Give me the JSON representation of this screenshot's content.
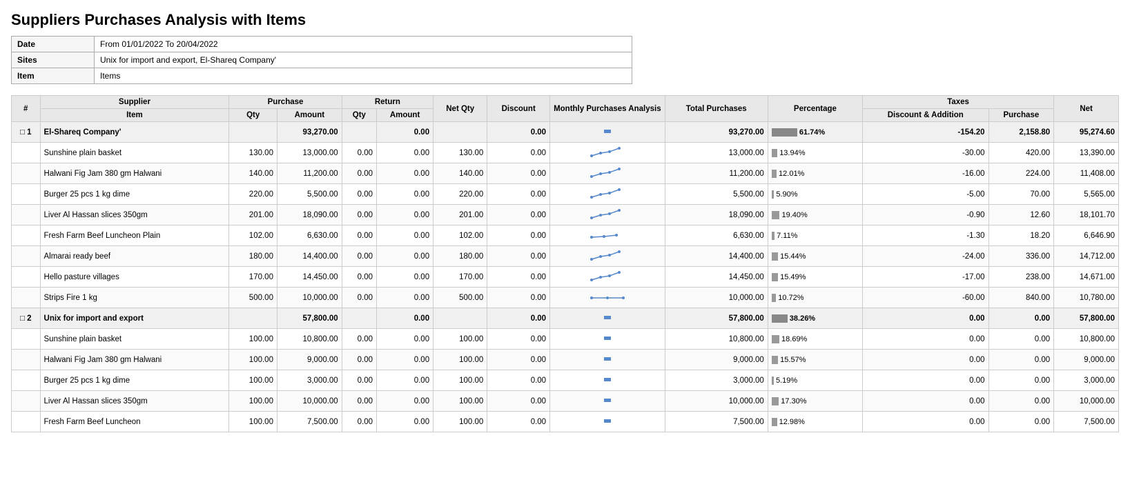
{
  "title": "Suppliers Purchases Analysis with Items",
  "meta": {
    "date_label": "Date",
    "date_value": "From 01/01/2022 To 20/04/2022",
    "sites_label": "Sites",
    "sites_value": "Unix for import and export, El-Shareq Company'",
    "item_label": "Item",
    "item_value": "Items"
  },
  "table": {
    "headers": {
      "hash": "#",
      "supplier": "Supplier",
      "item": "Item",
      "purchase": "Purchase",
      "purchase_qty": "Qty",
      "purchase_amount": "Amount",
      "return": "Return",
      "return_qty": "Qty",
      "return_amount": "Amount",
      "net_qty": "Net Qty",
      "discount": "Discount",
      "monthly_analysis": "Monthly Purchases Analysis",
      "total_purchases": "Total Purchases",
      "percentage": "Percentage",
      "taxes": "Taxes",
      "taxes_discount": "Discount & Addition",
      "taxes_purchase": "Purchase",
      "net": "Net"
    },
    "suppliers": [
      {
        "id": 1,
        "name": "El-Shareq Company'",
        "purchase_amount": "93,270.00",
        "return_amount": "0.00",
        "discount": "0.00",
        "total_purchases": "93,270.00",
        "percentage": 61.74,
        "percentage_label": "61.74%",
        "taxes_discount": "-154.20",
        "taxes_purchase": "2,158.80",
        "net": "95,274.60",
        "items": [
          {
            "name": "Sunshine plain basket",
            "purchase_qty": "130.00",
            "purchase_amount": "13,000.00",
            "return_qty": "0.00",
            "return_amount": "0.00",
            "net_qty": "130.00",
            "discount": "0.00",
            "total_purchases": "13,000.00",
            "percentage": 13.94,
            "percentage_label": "13.94%",
            "taxes_discount": "-30.00",
            "taxes_purchase": "420.00",
            "net": "13,390.00",
            "trend": "up"
          },
          {
            "name": "Halwani Fig Jam 380 gm Halwani",
            "purchase_qty": "140.00",
            "purchase_amount": "11,200.00",
            "return_qty": "0.00",
            "return_amount": "0.00",
            "net_qty": "140.00",
            "discount": "0.00",
            "total_purchases": "11,200.00",
            "percentage": 12.01,
            "percentage_label": "12.01%",
            "taxes_discount": "-16.00",
            "taxes_purchase": "224.00",
            "net": "11,408.00",
            "trend": "up"
          },
          {
            "name": "Burger 25 pcs 1 kg dime",
            "purchase_qty": "220.00",
            "purchase_amount": "5,500.00",
            "return_qty": "0.00",
            "return_amount": "0.00",
            "net_qty": "220.00",
            "discount": "0.00",
            "total_purchases": "5,500.00",
            "percentage": 5.9,
            "percentage_label": "5.90%",
            "taxes_discount": "-5.00",
            "taxes_purchase": "70.00",
            "net": "5,565.00",
            "trend": "up"
          },
          {
            "name": "Liver Al Hassan slices 350gm",
            "purchase_qty": "201.00",
            "purchase_amount": "18,090.00",
            "return_qty": "0.00",
            "return_amount": "0.00",
            "net_qty": "201.00",
            "discount": "0.00",
            "total_purchases": "18,090.00",
            "percentage": 19.4,
            "percentage_label": "19.40%",
            "taxes_discount": "-0.90",
            "taxes_purchase": "12.60",
            "net": "18,101.70",
            "trend": "up"
          },
          {
            "name": "Fresh Farm Beef Luncheon Plain",
            "purchase_qty": "102.00",
            "purchase_amount": "6,630.00",
            "return_qty": "0.00",
            "return_amount": "0.00",
            "net_qty": "102.00",
            "discount": "0.00",
            "total_purchases": "6,630.00",
            "percentage": 7.11,
            "percentage_label": "7.11%",
            "taxes_discount": "-1.30",
            "taxes_purchase": "18.20",
            "net": "6,646.90",
            "trend": "slight_up"
          },
          {
            "name": "Almarai ready beef",
            "purchase_qty": "180.00",
            "purchase_amount": "14,400.00",
            "return_qty": "0.00",
            "return_amount": "0.00",
            "net_qty": "180.00",
            "discount": "0.00",
            "total_purchases": "14,400.00",
            "percentage": 15.44,
            "percentage_label": "15.44%",
            "taxes_discount": "-24.00",
            "taxes_purchase": "336.00",
            "net": "14,712.00",
            "trend": "up"
          },
          {
            "name": "Hello pasture villages",
            "purchase_qty": "170.00",
            "purchase_amount": "14,450.00",
            "return_qty": "0.00",
            "return_amount": "0.00",
            "net_qty": "170.00",
            "discount": "0.00",
            "total_purchases": "14,450.00",
            "percentage": 15.49,
            "percentage_label": "15.49%",
            "taxes_discount": "-17.00",
            "taxes_purchase": "238.00",
            "net": "14,671.00",
            "trend": "up"
          },
          {
            "name": "Strips Fire 1 kg",
            "purchase_qty": "500.00",
            "purchase_amount": "10,000.00",
            "return_qty": "0.00",
            "return_amount": "0.00",
            "net_qty": "500.00",
            "discount": "0.00",
            "total_purchases": "10,000.00",
            "percentage": 10.72,
            "percentage_label": "10.72%",
            "taxes_discount": "-60.00",
            "taxes_purchase": "840.00",
            "net": "10,780.00",
            "trend": "flat"
          }
        ]
      },
      {
        "id": 2,
        "name": "Unix for import and export",
        "purchase_amount": "57,800.00",
        "return_amount": "0.00",
        "discount": "0.00",
        "total_purchases": "57,800.00",
        "percentage": 38.26,
        "percentage_label": "38.26%",
        "taxes_discount": "0.00",
        "taxes_purchase": "0.00",
        "net": "57,800.00",
        "items": [
          {
            "name": "Sunshine plain basket",
            "purchase_qty": "100.00",
            "purchase_amount": "10,800.00",
            "return_qty": "0.00",
            "return_amount": "0.00",
            "net_qty": "100.00",
            "discount": "0.00",
            "total_purchases": "10,800.00",
            "percentage": 18.69,
            "percentage_label": "18.69%",
            "taxes_discount": "0.00",
            "taxes_purchase": "0.00",
            "net": "10,800.00",
            "trend": "dot"
          },
          {
            "name": "Halwani Fig Jam 380 gm Halwani",
            "purchase_qty": "100.00",
            "purchase_amount": "9,000.00",
            "return_qty": "0.00",
            "return_amount": "0.00",
            "net_qty": "100.00",
            "discount": "0.00",
            "total_purchases": "9,000.00",
            "percentage": 15.57,
            "percentage_label": "15.57%",
            "taxes_discount": "0.00",
            "taxes_purchase": "0.00",
            "net": "9,000.00",
            "trend": "dot"
          },
          {
            "name": "Burger 25 pcs 1 kg dime",
            "purchase_qty": "100.00",
            "purchase_amount": "3,000.00",
            "return_qty": "0.00",
            "return_amount": "0.00",
            "net_qty": "100.00",
            "discount": "0.00",
            "total_purchases": "3,000.00",
            "percentage": 5.19,
            "percentage_label": "5.19%",
            "taxes_discount": "0.00",
            "taxes_purchase": "0.00",
            "net": "3,000.00",
            "trend": "dot"
          },
          {
            "name": "Liver Al Hassan slices 350gm",
            "purchase_qty": "100.00",
            "purchase_amount": "10,000.00",
            "return_qty": "0.00",
            "return_amount": "0.00",
            "net_qty": "100.00",
            "discount": "0.00",
            "total_purchases": "10,000.00",
            "percentage": 17.3,
            "percentage_label": "17.30%",
            "taxes_discount": "0.00",
            "taxes_purchase": "0.00",
            "net": "10,000.00",
            "trend": "dot"
          },
          {
            "name": "Fresh Farm Beef Luncheon",
            "purchase_qty": "100.00",
            "purchase_amount": "7,500.00",
            "return_qty": "0.00",
            "return_amount": "0.00",
            "net_qty": "100.00",
            "discount": "0.00",
            "total_purchases": "7,500.00",
            "percentage": 12.98,
            "percentage_label": "12.98%",
            "taxes_discount": "0.00",
            "taxes_purchase": "0.00",
            "net": "7,500.00",
            "trend": "dot"
          }
        ]
      }
    ]
  }
}
